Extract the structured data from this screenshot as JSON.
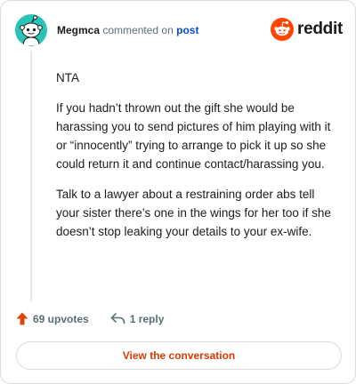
{
  "comment": {
    "username": "Megmca",
    "action_text": "commented on",
    "target_text": "post",
    "paragraphs": [
      "NTA",
      "If you hadn’t thrown out the gift she would be harassing you to send pictures of him playing with it or “innocently” trying to arrange to pick it up so she could return it and continue contact/harassing you.",
      "Talk to a lawyer about a restraining order abs tell your sister there’s one in the wings for her too if she doesn’t stop leaking your details to your ex-wife."
    ]
  },
  "brand": {
    "name": "reddit",
    "icon": "reddit-alien-icon",
    "color": "#ff4500"
  },
  "avatar": {
    "icon": "snoo-avatar-icon",
    "color": "#29c4b8"
  },
  "actions": {
    "upvotes_label": "69 upvotes",
    "upvote_icon": "upvote-arrow-icon",
    "upvote_color": "#e2450a",
    "reply_label": "1 reply",
    "reply_icon": "reply-arrow-icon"
  },
  "cta": {
    "label": "View the conversation",
    "color": "#d93a00"
  }
}
